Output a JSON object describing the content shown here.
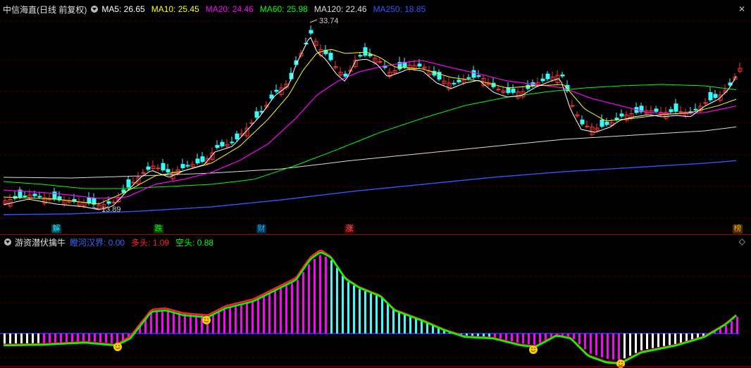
{
  "main_panel": {
    "title": "中信海直(日线 前复权)",
    "ma_items": [
      {
        "label": "MA5: 26.65",
        "color": "#ffffff"
      },
      {
        "label": "MA10: 25.45",
        "color": "#ffff00"
      },
      {
        "label": "MA20: 24.46",
        "color": "#ff00ff"
      },
      {
        "label": "MA60: 25.98",
        "color": "#00ff00"
      },
      {
        "label": "MA120: 22.46",
        "color": "#dddddd"
      },
      {
        "label": "MA250: 18.85",
        "color": "#3355ff"
      }
    ],
    "close_glyph": "✕",
    "high_label": "33.74",
    "low_label": "13.89",
    "events": [
      {
        "label": "解",
        "color": "#00ffff",
        "bg": "#003a4a"
      },
      {
        "label": "跌",
        "color": "#00ff00",
        "bg": "#003a00"
      },
      {
        "label": "财",
        "color": "#00c0ff",
        "bg": "#002a4a"
      },
      {
        "label": "涨",
        "color": "#ff6666",
        "bg": "#4a0000"
      },
      {
        "label": "榜",
        "color": "#ffaa00",
        "bg": "#4a2a00"
      }
    ]
  },
  "indicator_panel": {
    "title": "游资潜伏擒牛",
    "items": [
      {
        "label": "瞪河汉界: 0.00",
        "color": "#3366ff"
      },
      {
        "label": "多头: 1.09",
        "color": "#ff2222"
      },
      {
        "label": "空头: 0.88",
        "color": "#00ff00"
      }
    ],
    "settings_glyph": "◇"
  },
  "colors": {
    "up": "#ff3333",
    "down": "#33ffff",
    "grid": "#7a0000",
    "separator": "#9b0000",
    "ma5": "#ffffff",
    "ma10": "#ffff00",
    "ma20": "#ff00ff",
    "ma60": "#00ff00",
    "ma120": "#dddddd",
    "ma250": "#3355ff",
    "long": "#ff2222",
    "short": "#00ff00",
    "bar_up": "#ff00ff",
    "bar_down": "#33ffff",
    "bar_neutral": "#ffffff",
    "smiley": "#ffd000"
  }
}
